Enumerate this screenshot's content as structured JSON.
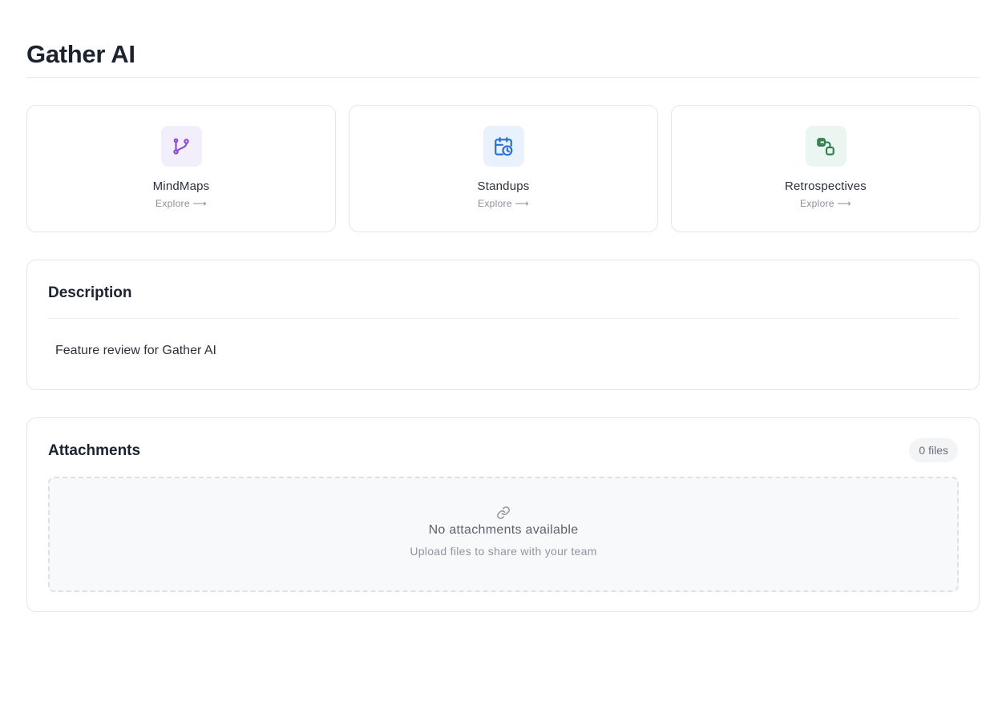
{
  "page": {
    "title": "Gather AI"
  },
  "features": [
    {
      "label": "MindMaps",
      "link": "Explore ⟶",
      "icon": "git-branch-icon",
      "tile_bg": "#f3eefc",
      "icon_color": "#8a4ccf"
    },
    {
      "label": "Standups",
      "link": "Explore ⟶",
      "icon": "calendar-clock-icon",
      "tile_bg": "#e8f1fc",
      "icon_color": "#2a6fcf"
    },
    {
      "label": "Retrospectives",
      "link": "Explore ⟶",
      "icon": "link-squares-icon",
      "tile_bg": "#eaf6ef",
      "icon_color": "#2f8050"
    }
  ],
  "description": {
    "heading": "Description",
    "text": "Feature review for Gather AI"
  },
  "attachments": {
    "heading": "Attachments",
    "count_label": "0 files",
    "empty_title": "No attachments available",
    "empty_subtitle": "Upload files to share with your team",
    "icon": "paperclip-icon"
  }
}
